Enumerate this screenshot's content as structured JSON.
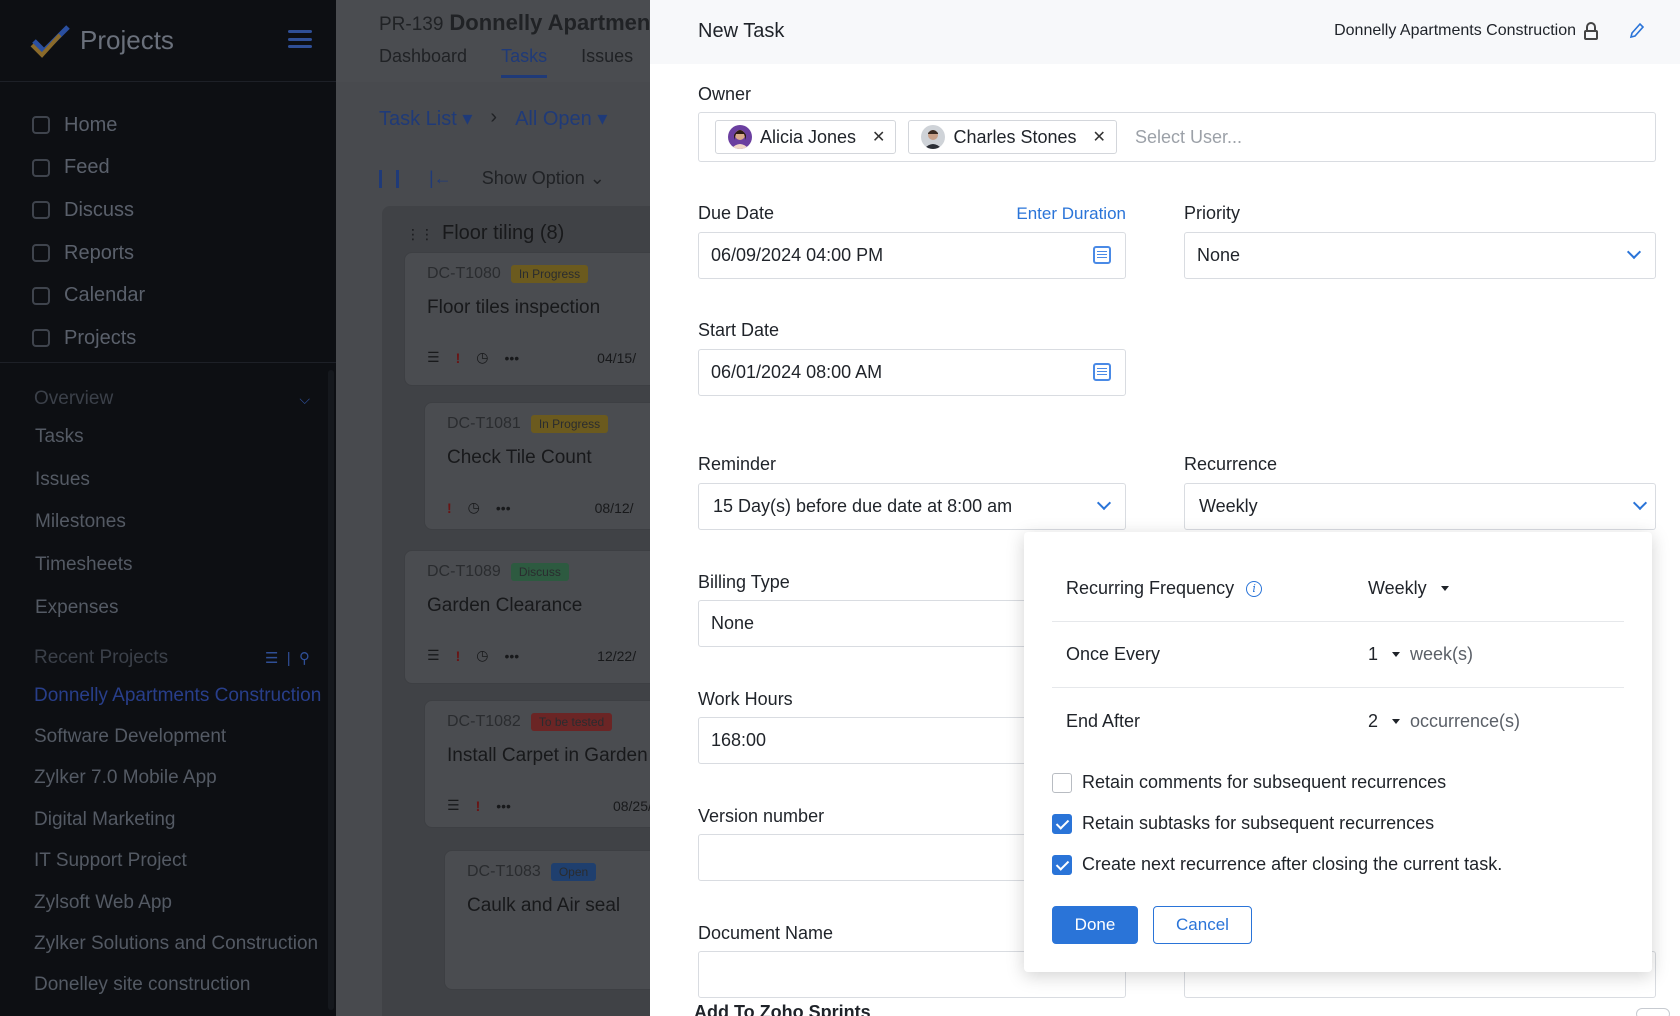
{
  "sidebar": {
    "app_title": "Projects",
    "nav": [
      "Home",
      "Feed",
      "Discuss",
      "Reports",
      "Calendar",
      "Projects"
    ],
    "overview_label": "Overview",
    "overview_items": [
      "Tasks",
      "Issues",
      "Milestones",
      "Timesheets",
      "Expenses"
    ],
    "recent_label": "Recent Projects",
    "recent_items": [
      "Donnelly Apartments Construction",
      "Software Development",
      "Zylker 7.0 Mobile App",
      "Digital Marketing",
      "IT Support Project",
      "Zylsoft Web App",
      "Zylker Solutions and Construction",
      "Donelley site construction"
    ]
  },
  "project": {
    "id": "PR-139",
    "name": "Donnelly Apartments Construction",
    "tabs": [
      "Dashboard",
      "Tasks",
      "Issues"
    ],
    "crumb_view": "Task List",
    "crumb_filter": "All Open",
    "show_option": "Show Option"
  },
  "board": {
    "column_title": "Floor tiling (8)",
    "cards": [
      {
        "id": "DC-T1080",
        "status": "In Progress",
        "title": "Floor tiles inspection",
        "date": "04/15/"
      },
      {
        "id": "DC-T1081",
        "status": "In Progress",
        "title": "Check Tile Count",
        "date": "08/12/"
      },
      {
        "id": "DC-T1089",
        "status": "Discuss",
        "title": "Garden Clearance",
        "date": "12/22/"
      },
      {
        "id": "DC-T1082",
        "status": "To be tested",
        "title": "Install Carpet in Garden",
        "date": "08/25/"
      },
      {
        "id": "DC-T1083",
        "status": "Open",
        "title": "Caulk and Air seal",
        "date": ""
      }
    ]
  },
  "panel": {
    "title": "New Task",
    "project_name": "Donnelly Apartments Construction",
    "owner_label": "Owner",
    "owners": [
      "Alicia Jones",
      "Charles Stones"
    ],
    "owner_placeholder": "Select User...",
    "due_label": "Due Date",
    "due_link": "Enter Duration",
    "due_value": "06/09/2024 04:00 PM",
    "priority_label": "Priority",
    "priority_value": "None",
    "start_label": "Start Date",
    "start_value": "06/01/2024 08:00 AM",
    "reminder_label": "Reminder",
    "reminder_value": "15 Day(s) before due date at 8:00 am",
    "recurrence_label": "Recurrence",
    "recurrence_value": "Weekly",
    "billing_label": "Billing Type",
    "billing_value": "None",
    "hours_label": "Work Hours",
    "hours_value": "168:00",
    "version_label": "Version number",
    "version_value": "",
    "doc_label": "Document Name",
    "bottom_hint": "Add To Zoho Sprints"
  },
  "recurrence_popover": {
    "freq_label": "Recurring Frequency",
    "freq_value": "Weekly",
    "every_label": "Once Every",
    "every_value": "1",
    "every_unit": "week(s)",
    "end_label": "End After",
    "end_value": "2",
    "end_unit": "occurrence(s)",
    "options": [
      {
        "label": "Retain comments for subsequent recurrences",
        "checked": false
      },
      {
        "label": "Retain subtasks for subsequent recurrences",
        "checked": true
      },
      {
        "label": "Create next recurrence after closing the current task.",
        "checked": true
      }
    ],
    "done_label": "Done",
    "cancel_label": "Cancel"
  },
  "colors": {
    "accent": "#2a74d8",
    "sidebar_bg": "#0d0f13",
    "overlay_bg": "#484a4e"
  }
}
